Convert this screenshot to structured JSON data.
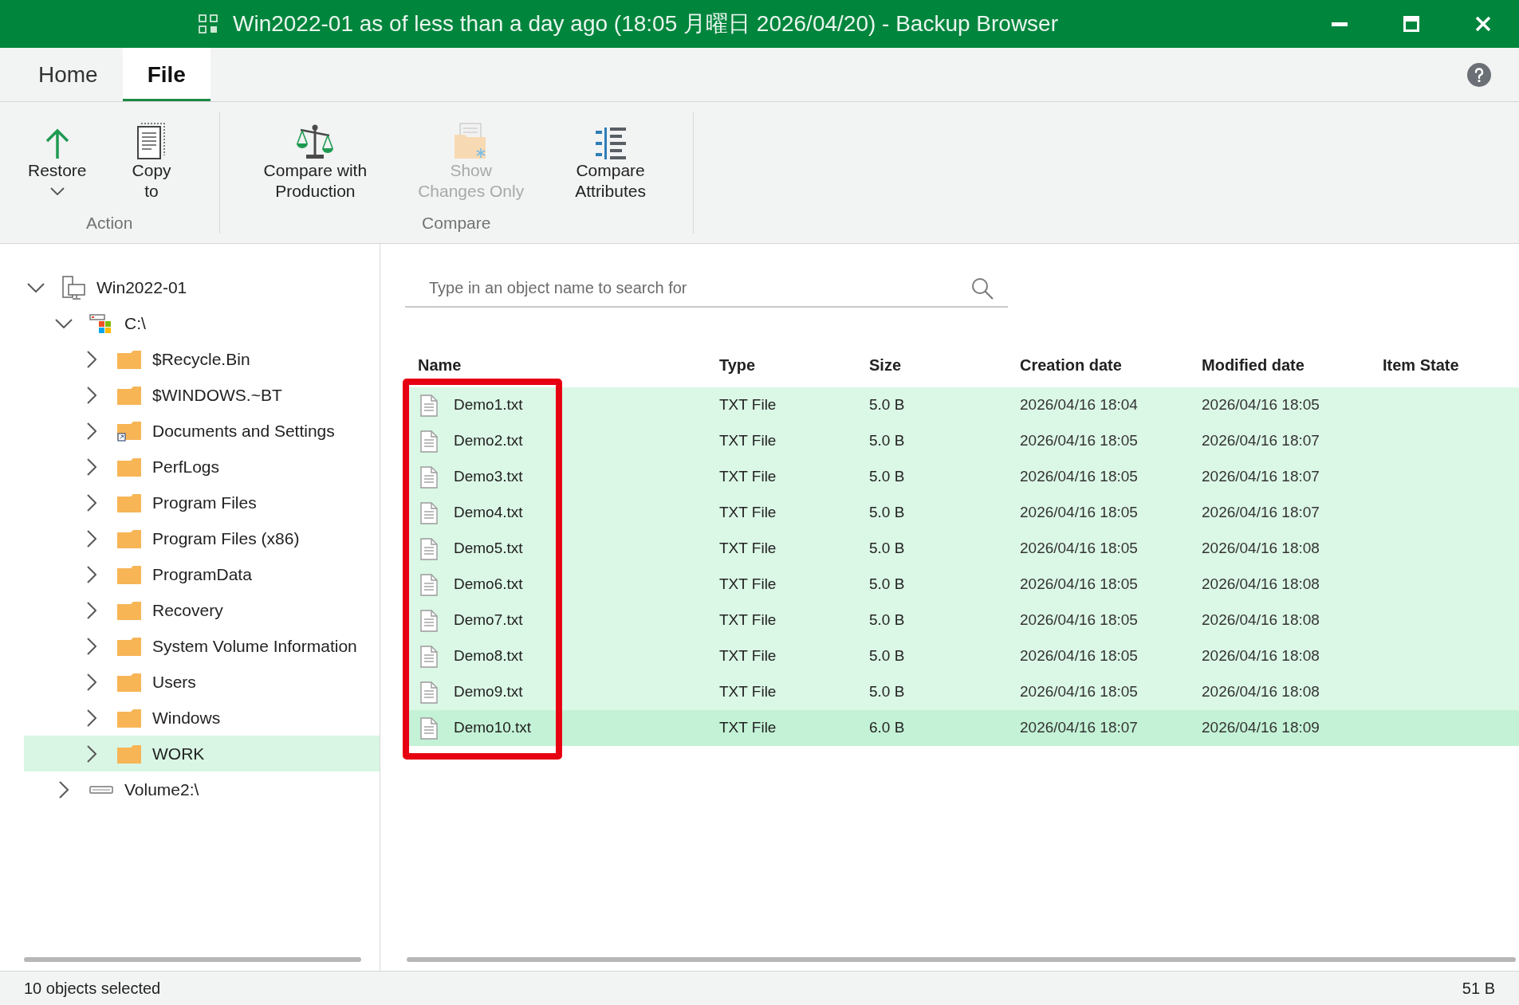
{
  "window": {
    "title": "Win2022-01 as of less than a day ago (18:05 月曜日 2026/04/20) - Backup Browser"
  },
  "ribbon_tabs": [
    {
      "label": "Home",
      "selected": false
    },
    {
      "label": "File",
      "selected": true
    }
  ],
  "ribbon_groups": [
    {
      "label": "Action",
      "buttons": [
        {
          "kind": "restore",
          "lines": [
            "Restore"
          ],
          "dropdown": true,
          "disabled": false
        },
        {
          "kind": "copy",
          "lines": [
            "Copy",
            "to"
          ],
          "dropdown": false,
          "disabled": false
        }
      ]
    },
    {
      "label": "Compare",
      "buttons": [
        {
          "kind": "compare",
          "lines": [
            "Compare with",
            "Production"
          ],
          "dropdown": false,
          "disabled": false
        },
        {
          "kind": "changes",
          "lines": [
            "Show",
            "Changes Only"
          ],
          "dropdown": false,
          "disabled": true
        },
        {
          "kind": "attributes",
          "lines": [
            "Compare",
            "Attributes"
          ],
          "dropdown": false,
          "disabled": false
        }
      ]
    }
  ],
  "tree": [
    {
      "label": "Win2022-01",
      "kind": "machine",
      "expanded": true,
      "selected": false,
      "children": [
        {
          "label": "C:\\",
          "kind": "system_drive",
          "expanded": true,
          "selected": false,
          "children": [
            {
              "label": "$Recycle.Bin",
              "kind": "folder",
              "expanded": false,
              "selected": false
            },
            {
              "label": "$WINDOWS.~BT",
              "kind": "folder",
              "expanded": false,
              "selected": false
            },
            {
              "label": "Documents and Settings",
              "kind": "linked_folder",
              "expanded": false,
              "selected": false
            },
            {
              "label": "PerfLogs",
              "kind": "folder",
              "expanded": false,
              "selected": false
            },
            {
              "label": "Program Files",
              "kind": "folder",
              "expanded": false,
              "selected": false
            },
            {
              "label": "Program Files (x86)",
              "kind": "folder",
              "expanded": false,
              "selected": false
            },
            {
              "label": "ProgramData",
              "kind": "folder",
              "expanded": false,
              "selected": false
            },
            {
              "label": "Recovery",
              "kind": "folder",
              "expanded": false,
              "selected": false
            },
            {
              "label": "System Volume Information",
              "kind": "folder",
              "expanded": false,
              "selected": false
            },
            {
              "label": "Users",
              "kind": "folder",
              "expanded": false,
              "selected": false
            },
            {
              "label": "Windows",
              "kind": "folder",
              "expanded": false,
              "selected": false
            },
            {
              "label": "WORK",
              "kind": "folder",
              "expanded": false,
              "selected": true
            }
          ]
        },
        {
          "label": "Volume2:\\",
          "kind": "drive",
          "expanded": false,
          "selected": false
        }
      ]
    }
  ],
  "search": {
    "placeholder": "Type in an object name to search for"
  },
  "table": {
    "columns": [
      "Name",
      "Type",
      "Size",
      "Creation date",
      "Modified date",
      "Item State"
    ],
    "name_column_outlined": true,
    "rows": [
      {
        "name": "Demo1.txt",
        "type": "TXT File",
        "size": "5.0 B",
        "created": "2026/04/16 18:04",
        "modified": "2026/04/16 18:05",
        "selected": true,
        "focused": false
      },
      {
        "name": "Demo2.txt",
        "type": "TXT File",
        "size": "5.0 B",
        "created": "2026/04/16 18:05",
        "modified": "2026/04/16 18:07",
        "selected": true,
        "focused": false
      },
      {
        "name": "Demo3.txt",
        "type": "TXT File",
        "size": "5.0 B",
        "created": "2026/04/16 18:05",
        "modified": "2026/04/16 18:07",
        "selected": true,
        "focused": false
      },
      {
        "name": "Demo4.txt",
        "type": "TXT File",
        "size": "5.0 B",
        "created": "2026/04/16 18:05",
        "modified": "2026/04/16 18:07",
        "selected": true,
        "focused": false
      },
      {
        "name": "Demo5.txt",
        "type": "TXT File",
        "size": "5.0 B",
        "created": "2026/04/16 18:05",
        "modified": "2026/04/16 18:08",
        "selected": true,
        "focused": false
      },
      {
        "name": "Demo6.txt",
        "type": "TXT File",
        "size": "5.0 B",
        "created": "2026/04/16 18:05",
        "modified": "2026/04/16 18:08",
        "selected": true,
        "focused": false
      },
      {
        "name": "Demo7.txt",
        "type": "TXT File",
        "size": "5.0 B",
        "created": "2026/04/16 18:05",
        "modified": "2026/04/16 18:08",
        "selected": true,
        "focused": false
      },
      {
        "name": "Demo8.txt",
        "type": "TXT File",
        "size": "5.0 B",
        "created": "2026/04/16 18:05",
        "modified": "2026/04/16 18:08",
        "selected": true,
        "focused": false
      },
      {
        "name": "Demo9.txt",
        "type": "TXT File",
        "size": "5.0 B",
        "created": "2026/04/16 18:05",
        "modified": "2026/04/16 18:08",
        "selected": true,
        "focused": false
      },
      {
        "name": "Demo10.txt",
        "type": "TXT File",
        "size": "6.0 B",
        "created": "2026/04/16 18:07",
        "modified": "2026/04/16 18:09",
        "selected": true,
        "focused": true
      }
    ]
  },
  "status_bar": {
    "left": "10 objects selected",
    "right": "51 B"
  }
}
